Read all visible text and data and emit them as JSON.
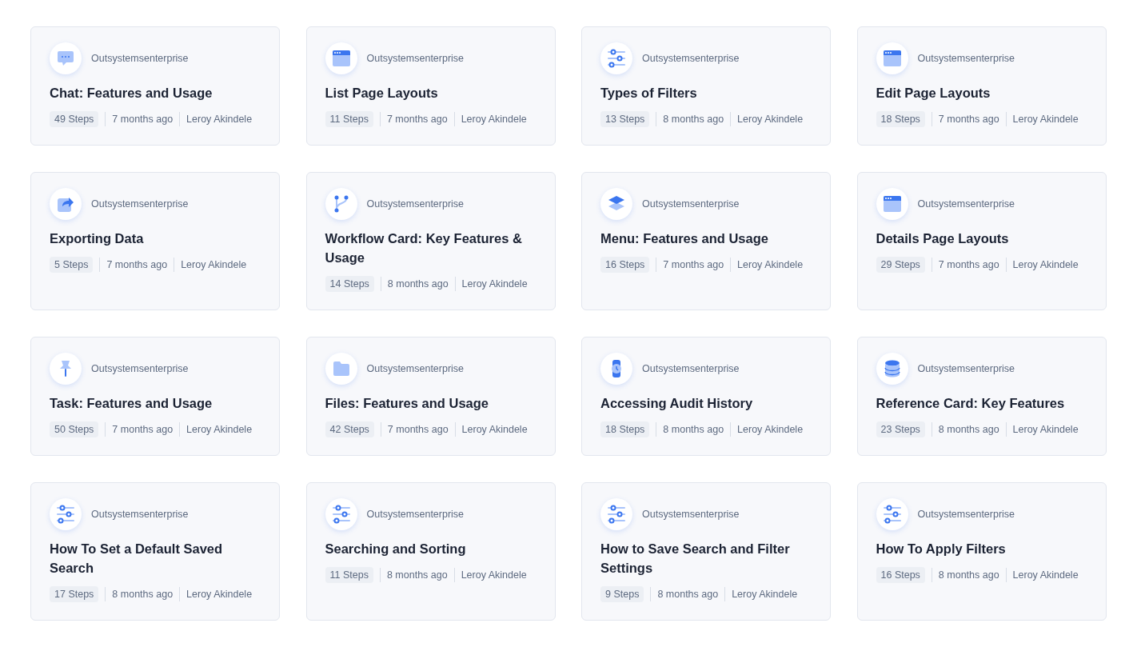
{
  "cards": [
    {
      "kind": "chat",
      "source": "Outsystemsenterprise",
      "title": "Chat: Features and Usage",
      "steps": "49 Steps",
      "age": "7 months ago",
      "author": "Leroy Akindele"
    },
    {
      "kind": "browser",
      "source": "Outsystemsenterprise",
      "title": "List Page Layouts",
      "steps": "11 Steps",
      "age": "7 months ago",
      "author": "Leroy Akindele"
    },
    {
      "kind": "sliders",
      "source": "Outsystemsenterprise",
      "title": "Types of Filters",
      "steps": "13 Steps",
      "age": "8 months ago",
      "author": "Leroy Akindele"
    },
    {
      "kind": "browser",
      "source": "Outsystemsenterprise",
      "title": "Edit Page Layouts",
      "steps": "18 Steps",
      "age": "7 months ago",
      "author": "Leroy Akindele"
    },
    {
      "kind": "export",
      "source": "Outsystemsenterprise",
      "title": "Exporting Data",
      "steps": "5 Steps",
      "age": "7 months ago",
      "author": "Leroy Akindele"
    },
    {
      "kind": "branch",
      "source": "Outsystemsenterprise",
      "title": "Workflow Card: Key Features & Usage",
      "steps": "14 Steps",
      "age": "8 months ago",
      "author": "Leroy Akindele"
    },
    {
      "kind": "layers",
      "source": "Outsystemsenterprise",
      "title": "Menu: Features and Usage",
      "steps": "16 Steps",
      "age": "7 months ago",
      "author": "Leroy Akindele"
    },
    {
      "kind": "browser",
      "source": "Outsystemsenterprise",
      "title": "Details Page Layouts",
      "steps": "29 Steps",
      "age": "7 months ago",
      "author": "Leroy Akindele"
    },
    {
      "kind": "pin",
      "source": "Outsystemsenterprise",
      "title": "Task: Features and Usage",
      "steps": "50 Steps",
      "age": "7 months ago",
      "author": "Leroy Akindele"
    },
    {
      "kind": "folder",
      "source": "Outsystemsenterprise",
      "title": "Files: Features and Usage",
      "steps": "42 Steps",
      "age": "7 months ago",
      "author": "Leroy Akindele"
    },
    {
      "kind": "watch",
      "source": "Outsystemsenterprise",
      "title": "Accessing Audit History",
      "steps": "18 Steps",
      "age": "8 months ago",
      "author": "Leroy Akindele"
    },
    {
      "kind": "database",
      "source": "Outsystemsenterprise",
      "title": "Reference Card: Key Features",
      "steps": "23 Steps",
      "age": "8 months ago",
      "author": "Leroy Akindele"
    },
    {
      "kind": "sliders",
      "source": "Outsystemsenterprise",
      "title": "How To Set a Default Saved Search",
      "steps": "17 Steps",
      "age": "8 months ago",
      "author": "Leroy Akindele"
    },
    {
      "kind": "sliders",
      "source": "Outsystemsenterprise",
      "title": "Searching and Sorting",
      "steps": "11 Steps",
      "age": "8 months ago",
      "author": "Leroy Akindele"
    },
    {
      "kind": "sliders",
      "source": "Outsystemsenterprise",
      "title": "How to Save Search and Filter Settings",
      "steps": "9 Steps",
      "age": "8 months ago",
      "author": "Leroy Akindele"
    },
    {
      "kind": "sliders",
      "source": "Outsystemsenterprise",
      "title": "How To Apply Filters",
      "steps": "16 Steps",
      "age": "8 months ago",
      "author": "Leroy Akindele"
    }
  ]
}
